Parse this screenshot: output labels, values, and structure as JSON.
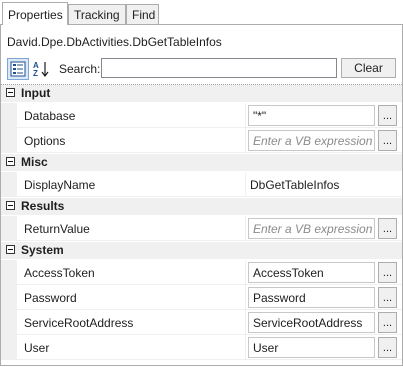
{
  "tabs": [
    {
      "label": "Properties",
      "active": true
    },
    {
      "label": "Tracking",
      "active": false
    },
    {
      "label": "Find",
      "active": false
    }
  ],
  "selected_type": "David.Dpe.DbActivities.DbGetTableInfos",
  "toolbar": {
    "categorized_icon": "categorized-view-icon",
    "alphabetical_icon": "sort-alphabetical-icon",
    "search_label": "Search:",
    "search_value": "",
    "clear_label": "Clear"
  },
  "grid": {
    "categories": {
      "input": "Input",
      "misc": "Misc",
      "results": "Results",
      "system": "System"
    },
    "properties": {
      "database": {
        "name": "Database",
        "value": "\"*\""
      },
      "options": {
        "name": "Options",
        "placeholder": "Enter a VB expression"
      },
      "display_name": {
        "name": "DisplayName",
        "value": "DbGetTableInfos"
      },
      "return_value": {
        "name": "ReturnValue",
        "placeholder": "Enter a VB expression"
      },
      "access_token": {
        "name": "AccessToken",
        "value": "AccessToken"
      },
      "password": {
        "name": "Password",
        "value": "Password"
      },
      "service_root_address": {
        "name": "ServiceRootAddress",
        "value": "ServiceRootAddress"
      },
      "user": {
        "name": "User",
        "value": "User"
      }
    },
    "ellipsis_label": "..."
  },
  "colors": {
    "category_bg": "#f0f0f0",
    "toggle_active_bg": "#dbe8f7",
    "placeholder_text": "#8a8a8a"
  }
}
